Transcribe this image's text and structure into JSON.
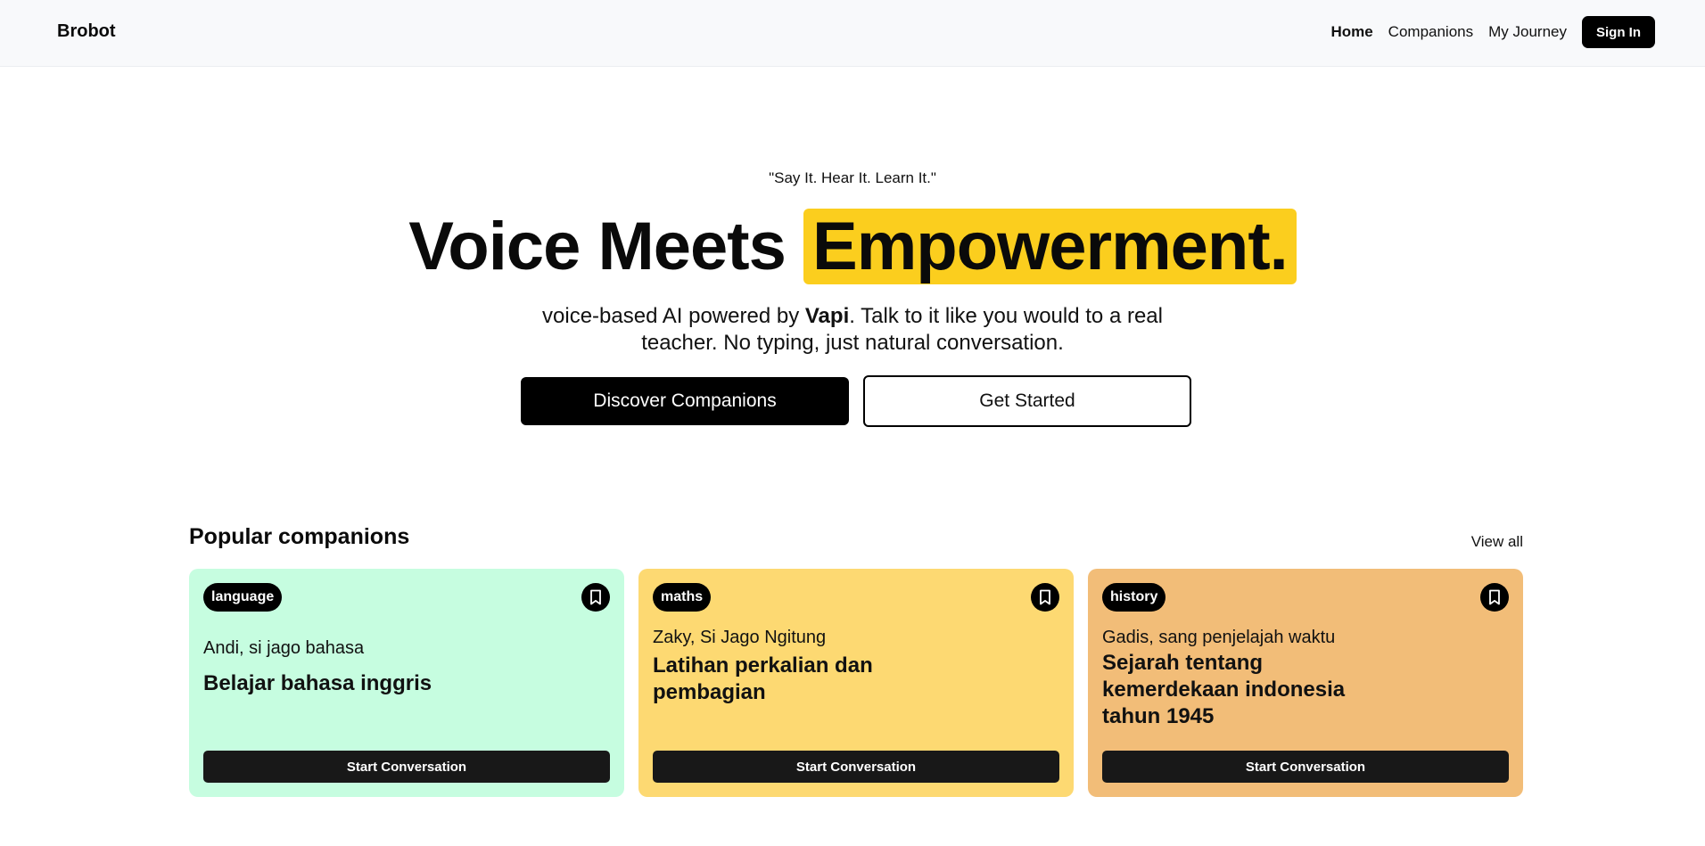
{
  "nav": {
    "brand": "Brobot",
    "links": [
      "Home",
      "Companions",
      "My Journey"
    ],
    "signin": "Sign In"
  },
  "hero": {
    "tagline": "\"Say It. Hear It. Learn It.\"",
    "headline_prefix": "Voice Meets",
    "headline_highlight": "Empowerment.",
    "sub_part1": "voice-based AI powered by",
    "sub_brand": "Vapi",
    "sub_part2": ". Talk to it like you would to a real teacher. No typing, just natural conversation.",
    "cta_primary": "Discover Companions",
    "cta_secondary": "Get Started"
  },
  "section": {
    "title": "Popular companions",
    "view_all": "View all"
  },
  "cards": [
    {
      "subject": "language",
      "name": "Andi, si jago bahasa",
      "topic": "Belajar bahasa inggris",
      "cta": "Start Conversation",
      "color": "#c6fde0",
      "icon": "bookmark-icon"
    },
    {
      "subject": "maths",
      "name": "Zaky, Si Jago Ngitung",
      "topic": "Latihan perkalian dan pembagian",
      "cta": "Start Conversation",
      "color": "#fdd972",
      "icon": "bookmark-icon"
    },
    {
      "subject": "history",
      "name": "Gadis, sang penjelajah waktu",
      "topic": "Sejarah tentang kemerdekaan indonesia tahun 1945",
      "cta": "Start Conversation",
      "color": "#f2bd78",
      "icon": "bookmark-icon"
    }
  ],
  "colors": {
    "accent_highlight": "#fbce1e",
    "primary_button": "#000000"
  }
}
